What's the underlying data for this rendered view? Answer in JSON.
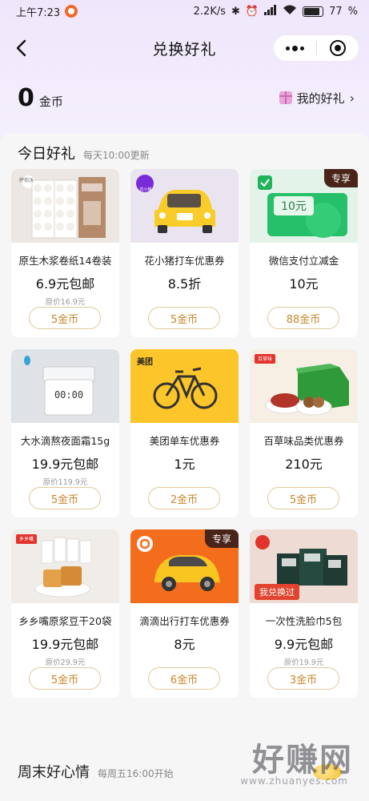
{
  "status_bar": {
    "time": "上午7:23",
    "net_speed": "2.2K/s",
    "battery": "77"
  },
  "nav": {
    "title": "兑换好礼"
  },
  "coins": {
    "count": "0",
    "unit": "金币",
    "my_gifts_label": "我的好礼"
  },
  "today": {
    "title": "今日好礼",
    "subtitle": "每天10:00更新",
    "items": [
      {
        "name": "原生木浆卷纸14卷装",
        "price": "6.9元包邮",
        "original": "原价16.9元",
        "cost": "5金币",
        "brand": "萨伯沃",
        "badge": ""
      },
      {
        "name": "花小猪打车优惠券",
        "price": "8.5折",
        "original": "",
        "cost": "5金币",
        "brand": "花小猪",
        "badge": ""
      },
      {
        "name": "微信支付立减金",
        "price": "10元",
        "original": "",
        "cost": "88金币",
        "brand": "10元",
        "badge": "专享"
      },
      {
        "name": "大水滴熬夜面霜15g",
        "price": "19.9元包邮",
        "original": "原价119.9元",
        "cost": "5金币",
        "brand": "00:00",
        "badge": ""
      },
      {
        "name": "美团单车优惠券",
        "price": "1元",
        "original": "",
        "cost": "2金币",
        "brand": "美团",
        "badge": ""
      },
      {
        "name": "百草味品类优惠券",
        "price": "210元",
        "original": "",
        "cost": "5金币",
        "brand": "百草味",
        "badge": ""
      },
      {
        "name": "乡乡嘴原浆豆干20袋",
        "price": "19.9元包邮",
        "original": "原价29.9元",
        "cost": "5金币",
        "brand": "乡乡嘴",
        "badge": ""
      },
      {
        "name": "滴滴出行打车优惠券",
        "price": "8元",
        "original": "",
        "cost": "6金币",
        "brand": "",
        "badge": "专享"
      },
      {
        "name": "一次性洗脸巾5包",
        "price": "9.9元包邮",
        "original": "原价19.9元",
        "cost": "3金币",
        "brand": "",
        "badge": "我兑换过"
      }
    ]
  },
  "weekend": {
    "title": "周末好心情",
    "subtitle": "每周五16:00开始"
  },
  "watermark": {
    "big": "好赚网",
    "small": "www.zhuanyes.com"
  }
}
